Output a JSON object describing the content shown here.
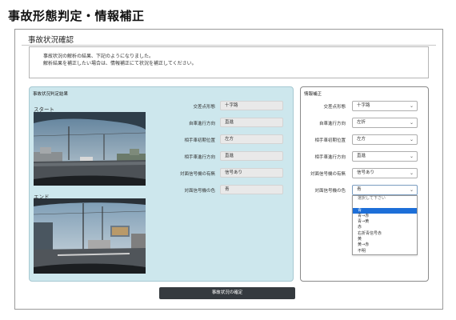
{
  "page": {
    "title": "事故形態判定・情報補正"
  },
  "section": {
    "title": "事故状況確認"
  },
  "message": {
    "line1": "事故状況の解析の結果、下記のようになりました。",
    "line2": "解析結果を補正したい場合は、情報補正にて状況を補正してください。"
  },
  "result": {
    "title": "事故状況判定結果",
    "start_label": "スタート",
    "end_label": "エンド",
    "fields": [
      {
        "label": "交差点形態",
        "value": "十字路"
      },
      {
        "label": "自車進行方向",
        "value": "直進"
      },
      {
        "label": "相手車初期位置",
        "value": "左方"
      },
      {
        "label": "相手車進行方向",
        "value": "直進"
      },
      {
        "label": "対面信号機の有無",
        "value": "信号あり"
      },
      {
        "label": "対面信号機の色",
        "value": "青"
      }
    ]
  },
  "correction": {
    "title": "情報補正",
    "fields": [
      {
        "label": "交差点形態",
        "value": "十字路"
      },
      {
        "label": "自車進行方向",
        "value": "左折"
      },
      {
        "label": "相手車初期位置",
        "value": "左方"
      },
      {
        "label": "相手車進行方向",
        "value": "直進"
      },
      {
        "label": "対面信号機の有無",
        "value": "信号あり"
      },
      {
        "label": "対面信号機の色",
        "value": "青"
      }
    ],
    "dropdown_options": [
      "選択して下さい",
      "",
      "青",
      "青→赤",
      "青→黄",
      "赤",
      "右折青信号赤",
      "黄",
      "黄→赤",
      "不明"
    ],
    "selected_index": 2
  },
  "buttons": {
    "confirm": "事故状況の確定"
  },
  "colors": {
    "result_panel_bg": "#cde7ed",
    "button_bg": "#353a3f",
    "selected_option_bg": "#1d6fd8"
  }
}
